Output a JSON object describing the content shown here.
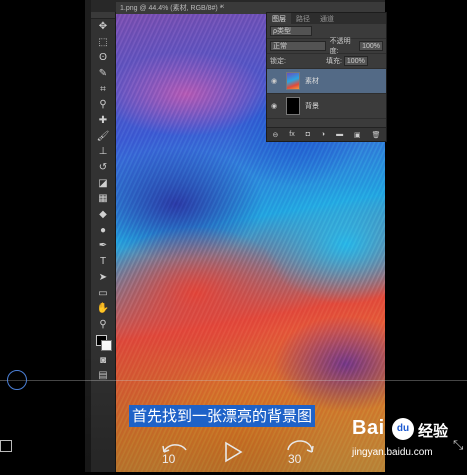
{
  "document": {
    "tab_title": "1.png @ 44.4% (素材, RGB/8#) *",
    "close": "×"
  },
  "layers_panel": {
    "tabs": [
      "图层",
      "路径",
      "通道"
    ],
    "kind_filter": "ρ类型",
    "blend_mode": "正常",
    "opacity_label": "不透明度:",
    "opacity_value": "100%",
    "lock_label": "锁定:",
    "fill_label": "填充:",
    "fill_value": "100%",
    "layers": [
      {
        "name": "素材",
        "selected": true,
        "visible": true
      },
      {
        "name": "背景",
        "selected": false,
        "visible": true
      }
    ],
    "footer_icons": [
      "link-icon",
      "fx-icon",
      "mask-icon",
      "adjustment-icon",
      "folder-icon",
      "new-layer-icon",
      "trash-icon"
    ],
    "footer_glyphs": [
      "⊖",
      "fx",
      "◘",
      "◑",
      "▬",
      "▣",
      "🗑"
    ]
  },
  "toolbar": {
    "tools": [
      {
        "name": "move-tool-icon",
        "glyph": "✥"
      },
      {
        "name": "marquee-tool-icon",
        "glyph": "⬚"
      },
      {
        "name": "lasso-tool-icon",
        "glyph": "ʘ"
      },
      {
        "name": "quick-select-tool-icon",
        "glyph": "✎"
      },
      {
        "name": "crop-tool-icon",
        "glyph": "⌗"
      },
      {
        "name": "eyedropper-tool-icon",
        "glyph": "⚲"
      },
      {
        "name": "healing-tool-icon",
        "glyph": "✚"
      },
      {
        "name": "brush-tool-icon",
        "glyph": "🖌"
      },
      {
        "name": "stamp-tool-icon",
        "glyph": "⊥"
      },
      {
        "name": "history-brush-tool-icon",
        "glyph": "↺"
      },
      {
        "name": "eraser-tool-icon",
        "glyph": "◪"
      },
      {
        "name": "gradient-tool-icon",
        "glyph": "▦"
      },
      {
        "name": "blur-tool-icon",
        "glyph": "◆"
      },
      {
        "name": "dodge-tool-icon",
        "glyph": "●"
      },
      {
        "name": "pen-tool-icon",
        "glyph": "✒"
      },
      {
        "name": "type-tool-icon",
        "glyph": "T"
      },
      {
        "name": "path-select-tool-icon",
        "glyph": "➤"
      },
      {
        "name": "rectangle-tool-icon",
        "glyph": "▭"
      },
      {
        "name": "hand-tool-icon",
        "glyph": "✋"
      },
      {
        "name": "zoom-tool-icon",
        "glyph": "⚲"
      }
    ],
    "bottom": [
      {
        "name": "edit-mode-icon",
        "glyph": "◙"
      },
      {
        "name": "screen-mode-icon",
        "glyph": "▤"
      }
    ]
  },
  "video": {
    "subtitle": "首先找到一张漂亮的背景图",
    "rewind_seconds": "10",
    "forward_seconds": "30",
    "fullscreen_glyph": "⤡",
    "progress_percent": 1
  },
  "watermark": {
    "brand": "Bai",
    "brand_paw": "du",
    "product": "经验",
    "url": "jingyan.baidu.com"
  },
  "colors": {
    "accent": "#1e62c8",
    "knob": "#4b7fd6",
    "panel": "#3b3b3b",
    "selected_layer": "#536a86"
  }
}
